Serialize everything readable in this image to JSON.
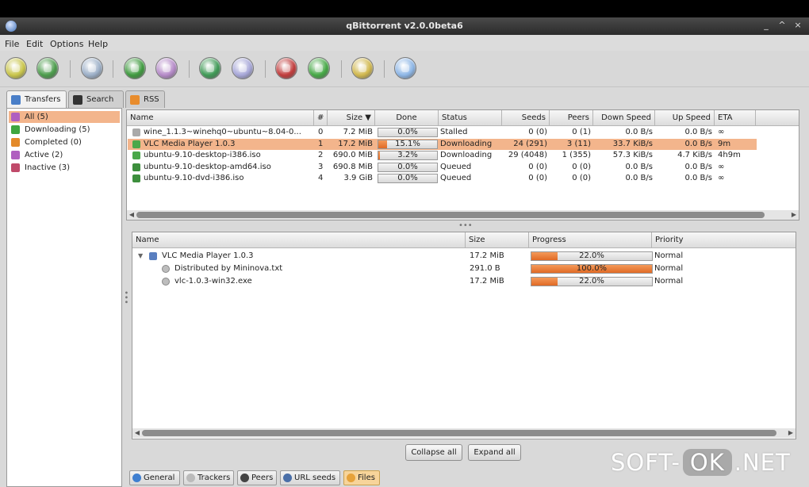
{
  "window": {
    "title": "qBittorrent v2.0.0beta6"
  },
  "menu": [
    "File",
    "Edit",
    "Options",
    "Help"
  ],
  "toolbar": {
    "buttons": [
      {
        "name": "add-torrent-icon",
        "color": "#c9c54a"
      },
      {
        "name": "add-url-icon",
        "color": "#4b9c4b"
      },
      {
        "name": "delete-icon",
        "color": "#9db0c8"
      },
      {
        "name": "start-icon",
        "color": "#3f9a3f"
      },
      {
        "name": "pause-icon",
        "color": "#b58ac8"
      },
      {
        "name": "start-all-icon",
        "color": "#3f9a56"
      },
      {
        "name": "pause-all-icon",
        "color": "#a7a7d8"
      },
      {
        "name": "decrease-priority-icon",
        "color": "#c13c3c"
      },
      {
        "name": "increase-priority-icon",
        "color": "#45a845"
      },
      {
        "name": "preferences-icon",
        "color": "#d1b84e"
      },
      {
        "name": "exit-icon",
        "color": "#8db6e6"
      }
    ]
  },
  "tabs": [
    {
      "label": "Transfers",
      "icon": "transfers-icon",
      "color": "#4a7fc8"
    },
    {
      "label": "Search",
      "icon": "search-icon",
      "color": "#333333"
    },
    {
      "label": "RSS",
      "icon": "rss-icon",
      "color": "#e88c2c"
    }
  ],
  "filters": [
    {
      "label": "All (5)",
      "icon": "all-icon",
      "color": "#b05fc0",
      "selected": true
    },
    {
      "label": "Downloading (5)",
      "icon": "downloading-icon",
      "color": "#3fa63f",
      "selected": false
    },
    {
      "label": "Completed (0)",
      "icon": "completed-icon",
      "color": "#e38a2a",
      "selected": false
    },
    {
      "label": "Active (2)",
      "icon": "active-icon",
      "color": "#b05fc0",
      "selected": false
    },
    {
      "label": "Inactive (3)",
      "icon": "inactive-icon",
      "color": "#c04a6a",
      "selected": false
    }
  ],
  "torrent_table": {
    "headers": [
      "Name",
      "#",
      "Size ▼",
      "Done",
      "Status",
      "Seeds",
      "Peers",
      "Down Speed",
      "Up Speed",
      "ETA"
    ],
    "rows": [
      {
        "name": "wine_1.1.3~winehq0~ubuntu~8.04-0...",
        "num": "0",
        "size": "7.2 MiB",
        "done": "0.0%",
        "progress": 0.0,
        "status": "Stalled",
        "seeds": "0 (0)",
        "peers": "0 (1)",
        "down": "0.0 B/s",
        "up": "0.0 B/s",
        "eta": "∞",
        "icon_color": "#aaaaaa",
        "selected": false
      },
      {
        "name": "VLC Media Player 1.0.3",
        "num": "1",
        "size": "17.2 MiB",
        "done": "15.1%",
        "progress": 0.151,
        "status": "Downloading",
        "seeds": "24 (291)",
        "peers": "3 (11)",
        "down": "33.7 KiB/s",
        "up": "0.0 B/s",
        "eta": "9m",
        "icon_color": "#4aa84a",
        "selected": true
      },
      {
        "name": "ubuntu-9.10-desktop-i386.iso",
        "num": "2",
        "size": "690.0 MiB",
        "done": "3.2%",
        "progress": 0.032,
        "status": "Downloading",
        "seeds": "29 (4048)",
        "peers": "1 (355)",
        "down": "57.3 KiB/s",
        "up": "4.7 KiB/s",
        "eta": "4h9m",
        "icon_color": "#4aa84a",
        "selected": false
      },
      {
        "name": "ubuntu-9.10-desktop-amd64.iso",
        "num": "3",
        "size": "690.8 MiB",
        "done": "0.0%",
        "progress": 0.0,
        "status": "Queued",
        "seeds": "0 (0)",
        "peers": "0 (0)",
        "down": "0.0 B/s",
        "up": "0.0 B/s",
        "eta": "∞",
        "icon_color": "#3d8f3d",
        "selected": false
      },
      {
        "name": "ubuntu-9.10-dvd-i386.iso",
        "num": "4",
        "size": "3.9 GiB",
        "done": "0.0%",
        "progress": 0.0,
        "status": "Queued",
        "seeds": "0 (0)",
        "peers": "0 (0)",
        "down": "0.0 B/s",
        "up": "0.0 B/s",
        "eta": "∞",
        "icon_color": "#3d8f3d",
        "selected": false
      }
    ]
  },
  "files_table": {
    "headers": [
      "Name",
      "Size",
      "Progress",
      "Priority"
    ],
    "rows": [
      {
        "name": "VLC Media Player 1.0.3",
        "size": "17.2 MiB",
        "progress_label": "22.0%",
        "progress": 0.22,
        "priority": "Normal",
        "level": 0,
        "folder": true
      },
      {
        "name": "Distributed by Mininova.txt",
        "size": "291.0 B",
        "progress_label": "100.0%",
        "progress": 1.0,
        "priority": "Normal",
        "level": 1,
        "folder": false
      },
      {
        "name": "vlc-1.0.3-win32.exe",
        "size": "17.2 MiB",
        "progress_label": "22.0%",
        "progress": 0.22,
        "priority": "Normal",
        "level": 1,
        "folder": false
      }
    ],
    "collapse_label": "Collapse all",
    "expand_label": "Expand all"
  },
  "bottom_tabs": [
    {
      "label": "General",
      "icon": "info-icon",
      "color": "#3f7fd0",
      "active": false
    },
    {
      "label": "Trackers",
      "icon": "trackers-icon",
      "color": "#bbbbbb",
      "active": false
    },
    {
      "label": "Peers",
      "icon": "peers-icon",
      "color": "#444444",
      "active": false
    },
    {
      "label": "URL seeds",
      "icon": "url-seeds-icon",
      "color": "#4a6fa8",
      "active": false
    },
    {
      "label": "Files",
      "icon": "files-icon",
      "color": "#e6a23a",
      "active": true
    }
  ],
  "watermark": {
    "left": "SOFT-",
    "mid": "OK",
    "right": ".NET"
  }
}
